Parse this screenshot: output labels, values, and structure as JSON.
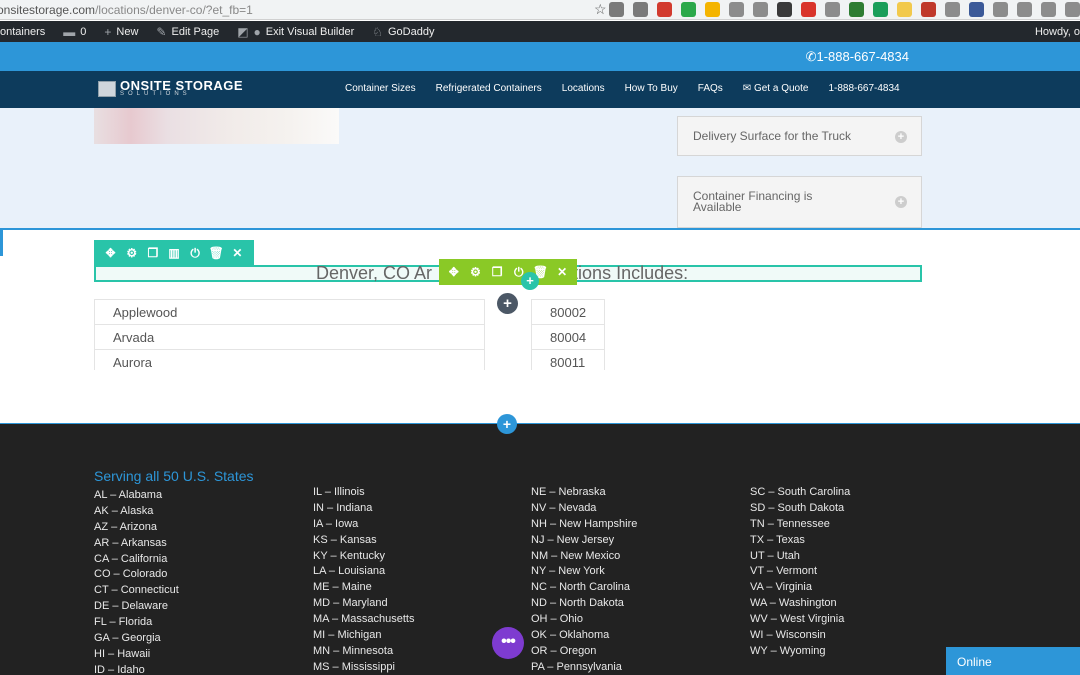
{
  "browser": {
    "url_main": "onsitestorage.com",
    "url_path": "/locations/denver-co/?et_fb=1",
    "extension_colors": [
      "#7a7a7a",
      "#7a7a7a",
      "#d23b2f",
      "#2ba84a",
      "#f4b400",
      "#8c8c8c",
      "#8c8c8c",
      "#3a3a3a",
      "#d9342b",
      "#8c8c8c",
      "#2e7d32",
      "#1a9e5a",
      "#f2c94c",
      "#c0392b",
      "#8c8c8c",
      "#3b5998",
      "#8c8c8c",
      "#8c8c8c",
      "#8c8c8c",
      "#8c8c8c"
    ]
  },
  "wpbar": {
    "site": "ontainers",
    "comments": "0",
    "new": "New",
    "edit": "Edit Page",
    "exit": "Exit Visual Builder",
    "godaddy": "GoDaddy",
    "howdy": "Howdy, o"
  },
  "topbar": {
    "phone": "1-888-667-4834"
  },
  "header": {
    "logo_main": "ONSITE STORAGE",
    "logo_sub": "SOLUTIONS",
    "nav": [
      "Container Sizes",
      "Refrigerated Containers",
      "Locations",
      "How To Buy",
      "FAQs",
      "Get a Quote",
      "1-888-667-4834"
    ]
  },
  "accordion": {
    "item1": "Delivery Surface for the Truck",
    "item2_line1": "Container Financing is",
    "item2_line2": "Available"
  },
  "builder": {
    "heading": "Denver, CO Ar",
    "heading_tail": "tions Includes:"
  },
  "cities": [
    "Applewood",
    "Arvada",
    "Aurora"
  ],
  "zips": [
    "80002",
    "80004",
    "80011"
  ],
  "footer": {
    "title": "Serving all 50 U.S. States",
    "col1": [
      "AL – Alabama",
      "AK – Alaska",
      "AZ – Arizona",
      "AR – Arkansas",
      "CA – California",
      "CO – Colorado",
      "CT – Connecticut",
      "DE – Delaware",
      "FL – Florida",
      "GA – Georgia",
      "HI – Hawaii",
      "ID – Idaho"
    ],
    "col2": [
      "IL – Illinois",
      "IN – Indiana",
      "IA – Iowa",
      "KS – Kansas",
      "KY – Kentucky",
      "LA – Louisiana",
      "ME – Maine",
      "MD – Maryland",
      "MA – Massachusetts",
      "MI – Michigan",
      "MN – Minnesota",
      "MS – Mississippi"
    ],
    "col3": [
      "NE – Nebraska",
      "NV – Nevada",
      "NH – New Hampshire",
      "NJ – New Jersey",
      "NM – New Mexico",
      "NY – New York",
      "NC – North Carolina",
      "ND – North Dakota",
      "OH – Ohio",
      "OK – Oklahoma",
      "OR – Oregon",
      "PA – Pennsylvania"
    ],
    "col4": [
      "SC – South Carolina",
      "SD – South Dakota",
      "TN – Tennessee",
      "TX – Texas",
      "UT – Utah",
      "VT – Vermont",
      "VA – Virginia",
      "WA – Washington",
      "WV – West Virginia",
      "WI – Wisconsin",
      "WY – Wyoming"
    ]
  },
  "chat": {
    "label": "Online"
  }
}
